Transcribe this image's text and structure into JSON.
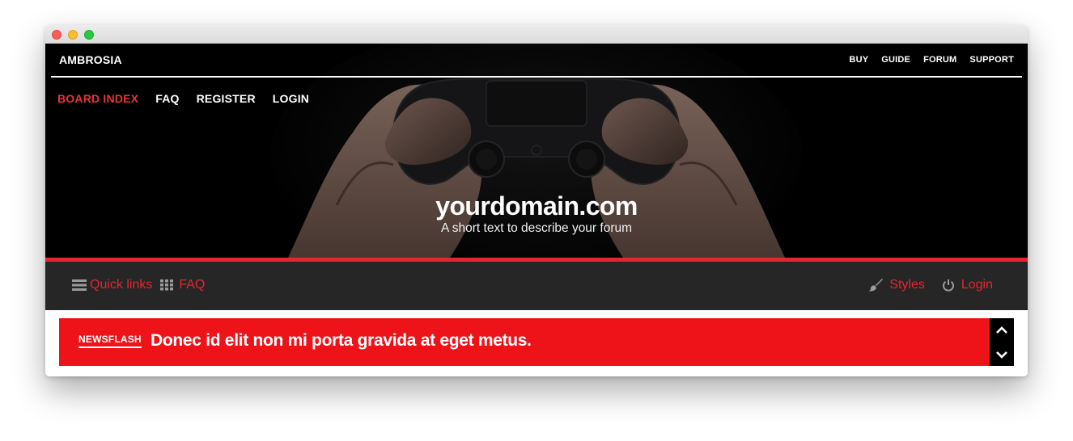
{
  "header": {
    "site_name": "AMBROSIA",
    "top_links": [
      "BUY",
      "GUIDE",
      "FORUM",
      "SUPPORT"
    ]
  },
  "main_nav": [
    {
      "label": "BOARD INDEX",
      "active": true
    },
    {
      "label": "FAQ",
      "active": false
    },
    {
      "label": "REGISTER",
      "active": false
    },
    {
      "label": "LOGIN",
      "active": false
    }
  ],
  "hero": {
    "title": "yourdomain.com",
    "description": "A short text to describe your forum"
  },
  "navbar": {
    "quick_links": {
      "label": "Quick links",
      "icon": "hamburger-icon"
    },
    "faq": {
      "label": "FAQ",
      "icon": "grid-icon"
    },
    "styles": {
      "label": "Styles",
      "icon": "paintbrush-icon"
    },
    "login": {
      "label": "Login",
      "icon": "power-icon"
    }
  },
  "newsflash": {
    "label": "NEWSFLASH",
    "text": "Donec id elit non mi porta gravida at eget metus."
  },
  "colors": {
    "accent": "#e4262f",
    "newsflash_bg": "#ee1219",
    "navbar_bg": "#262626",
    "header_bg": "#000000"
  }
}
